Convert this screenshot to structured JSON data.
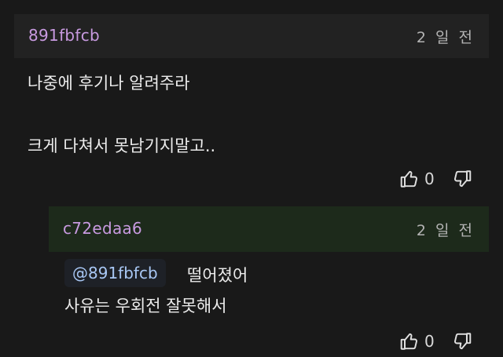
{
  "comment": {
    "author": "891fbfcb",
    "timestamp": "2 일 전",
    "lines": [
      "나중에 후기나 알려주라",
      "크게 다쳐서 못남기지말고.."
    ],
    "like_count": "0",
    "author_color": "#c89ae0"
  },
  "reply": {
    "author": "c72edaa6",
    "timestamp": "2 일 전",
    "mention": "@891fbfcb",
    "line1_text": "떨어졌어",
    "line2": "사유는 우회전 잘못해서",
    "like_count": "0",
    "author_color": "#c89ae0",
    "header_bg": "#1d2a1b"
  },
  "icons": {
    "like": "thumbs-up-icon",
    "dislike": "thumbs-down-icon"
  }
}
